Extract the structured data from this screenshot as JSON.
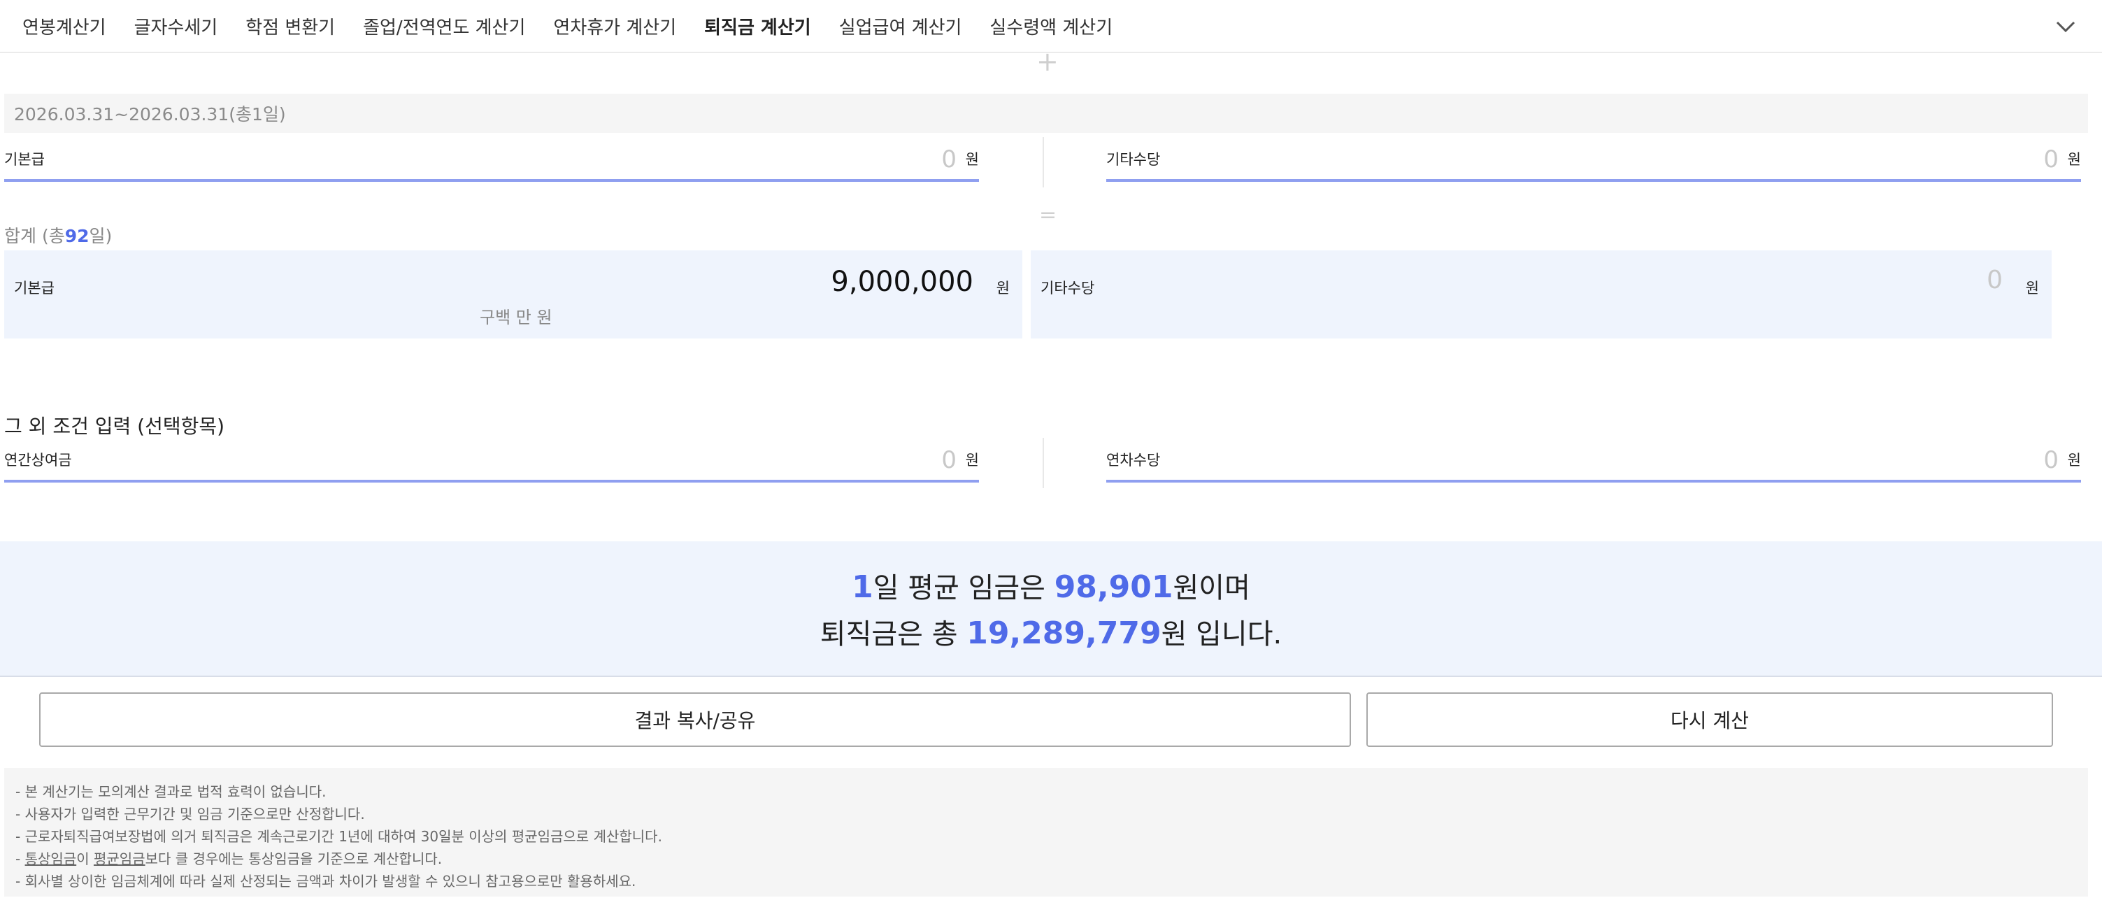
{
  "nav": {
    "tabs": [
      {
        "label": "연봉계산기"
      },
      {
        "label": "글자수세기"
      },
      {
        "label": "학점 변환기"
      },
      {
        "label": "졸업/전역연도 계산기"
      },
      {
        "label": "연차휴가 계산기"
      },
      {
        "label": "퇴직금 계산기",
        "active": true
      },
      {
        "label": "실업급여 계산기"
      },
      {
        "label": "실수령액 계산기"
      }
    ],
    "expand_icon": "chevron-down-icon"
  },
  "add_icon_glyph": "+",
  "period": "2026.03.31~2026.03.31(총1일)",
  "wage_inputs": {
    "base_label": "기본급",
    "base_value": "0",
    "base_unit": "원",
    "other_label": "기타수당",
    "other_value": "0",
    "other_unit": "원"
  },
  "equals_glyph": "=",
  "summary": {
    "prefix": "합계 (총",
    "days": "92",
    "suffix": "일)",
    "base_label": "기본급",
    "base_value": "9,000,000",
    "base_unit": "원",
    "base_korean": "구백 만 원",
    "other_label": "기타수당",
    "other_value": "0",
    "other_unit": "원"
  },
  "optional": {
    "title": "그 외 조건 입력 (선택항목)",
    "bonus_label": "연간상여금",
    "bonus_value": "0",
    "bonus_unit": "원",
    "annual_leave_label": "연차수당",
    "annual_leave_value": "0",
    "annual_leave_unit": "원"
  },
  "result": {
    "days": "1",
    "text1": "일 평균 임금은 ",
    "avg_wage": "98,901",
    "text2": "원이며",
    "text3": "퇴직금은 총 ",
    "severance": "19,289,779",
    "text4": "원 입니다."
  },
  "buttons": {
    "share": "결과 복사/공유",
    "reset": "다시 계산"
  },
  "notes": {
    "n1": "- 본 계산기는 모의계산 결과로 법적 효력이 없습니다.",
    "n2": "- 사용자가 입력한 근무기간 및 임금 기준으로만 산정합니다.",
    "n3": "- 근로자퇴직급여보장법에 의거 퇴직금은 계속근로기간 1년에 대하여 30일분 이상의 평균임금으로 계산합니다.",
    "n4_prefix": "- ",
    "n4_term1": "통상임금",
    "n4_mid": "이 ",
    "n4_term2": "평균임금",
    "n4_suffix": "보다 클 경우에는 통상임금을 기준으로 계산합니다.",
    "n5": "- 회사별 상이한 임금체계에 따라 실제 산정되는 금액과 차이가 발생할 수 있으니 참고용으로만 활용하세요."
  },
  "colors": {
    "accent": "#4f6ae8",
    "underline": "#8f9ff0",
    "panel": "#eff4fd"
  }
}
